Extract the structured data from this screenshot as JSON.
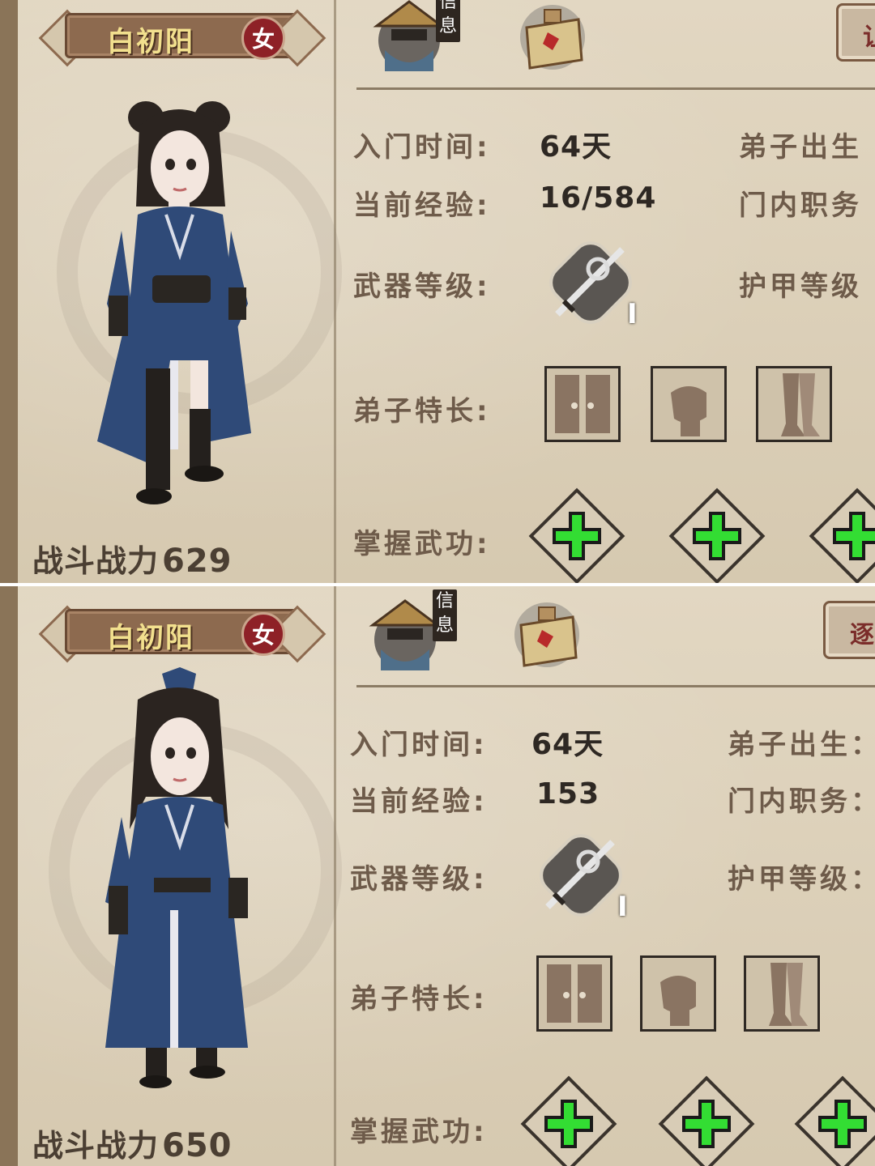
{
  "panels": [
    {
      "name": "白初阳",
      "gender": "女",
      "info_tag": "信息",
      "corner_button": "让",
      "power_label": "战斗战力",
      "power_value": "629",
      "fields": {
        "join_time_label": "入门时间:",
        "join_time_value": "64天",
        "exp_label": "当前经验:",
        "exp_value": "16/584",
        "weapon_label": "武器等级:",
        "weapon_level": "I",
        "traits_label": "弟子特长:",
        "martial_label": "掌握武功:",
        "birth_label": "弟子出生",
        "position_label": "门内职务",
        "armor_label": "护甲等级"
      }
    },
    {
      "name": "白初阳",
      "gender": "女",
      "info_tag": "信息",
      "corner_button": "逐",
      "power_label": "战斗战力",
      "power_value": "650",
      "fields": {
        "join_time_label": "入门时间:",
        "join_time_value": "64天",
        "exp_label": "当前经验:",
        "exp_value": "153",
        "weapon_label": "武器等级:",
        "weapon_level": "I",
        "traits_label": "弟子特长:",
        "martial_label": "掌握武功:",
        "birth_label": "弟子出生：",
        "position_label": "门内职务：",
        "armor_label": "护甲等级："
      }
    }
  ],
  "icons": {
    "info_avatar": "straw-hat-disciple-icon",
    "scroll": "scroll-map-icon",
    "weapon": "sword-hook-icon",
    "trait_1": "gate-door-icon",
    "trait_2": "fist-icon",
    "trait_3": "legs-icon",
    "martial_add": "plus-icon"
  },
  "colors": {
    "name_text": "#f2e08e",
    "gender_badge": "#8e2127",
    "label_text": "#6e5b4a",
    "value_text": "#2e2823",
    "plus_green": "#33dd33"
  }
}
